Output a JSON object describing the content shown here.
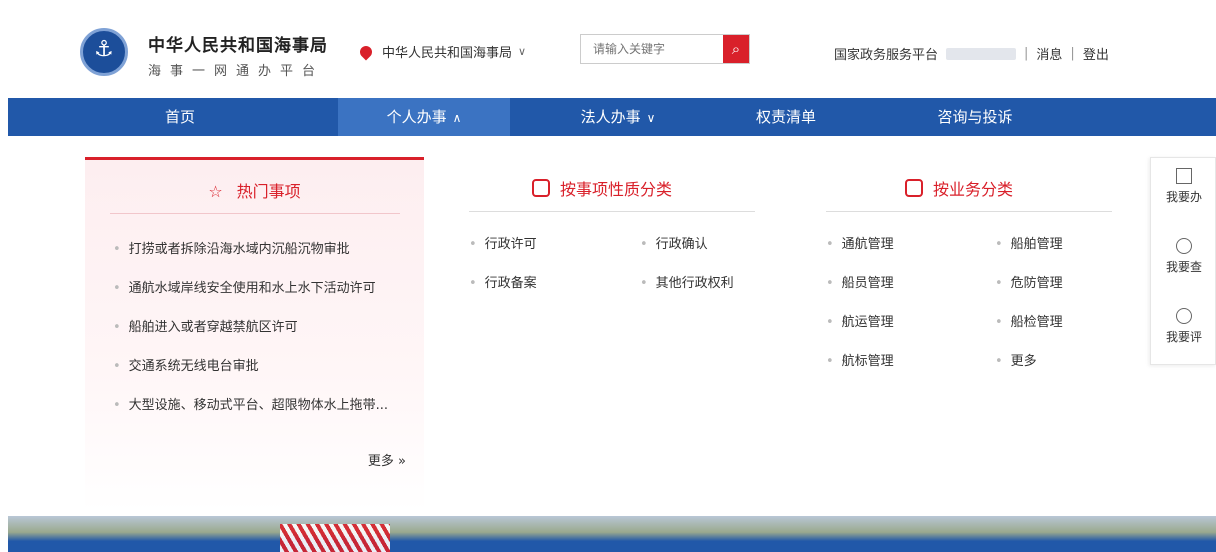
{
  "header": {
    "title": "中华人民共和国海事局",
    "subtitle": "海事一网通办平台",
    "location": "中华人民共和国海事局",
    "search_placeholder": "请输入关键字",
    "links": {
      "gov_platform": "国家政务服务平台",
      "separator": "|",
      "messages": "消息",
      "logout": "登出"
    }
  },
  "nav": {
    "items": [
      "首页",
      "个人办事",
      "法人办事",
      "权责清单",
      "咨询与投诉"
    ],
    "active": "个人办事"
  },
  "hot": {
    "title": "热门事项",
    "items": [
      "打捞或者拆除沿海水域内沉船沉物审批",
      "通航水域岸线安全使用和水上水下活动许可",
      "船舶进入或者穿越禁航区许可",
      "交通系统无线电台审批",
      "大型设施、移动式平台、超限物体水上拖带..."
    ],
    "more": "更多 »"
  },
  "by_nature": {
    "title": "按事项性质分类",
    "items": [
      "行政许可",
      "行政确认",
      "行政备案",
      "其他行政权利"
    ]
  },
  "by_business": {
    "title": "按业务分类",
    "items": [
      "通航管理",
      "船舶管理",
      "船员管理",
      "危防管理",
      "航运管理",
      "船检管理",
      "航标管理",
      "更多"
    ]
  },
  "tools": {
    "apply": "我要办",
    "query": "我要查",
    "review": "我要评"
  },
  "colors": {
    "primary_blue": "#2158a9",
    "accent_red": "#d9202a"
  }
}
